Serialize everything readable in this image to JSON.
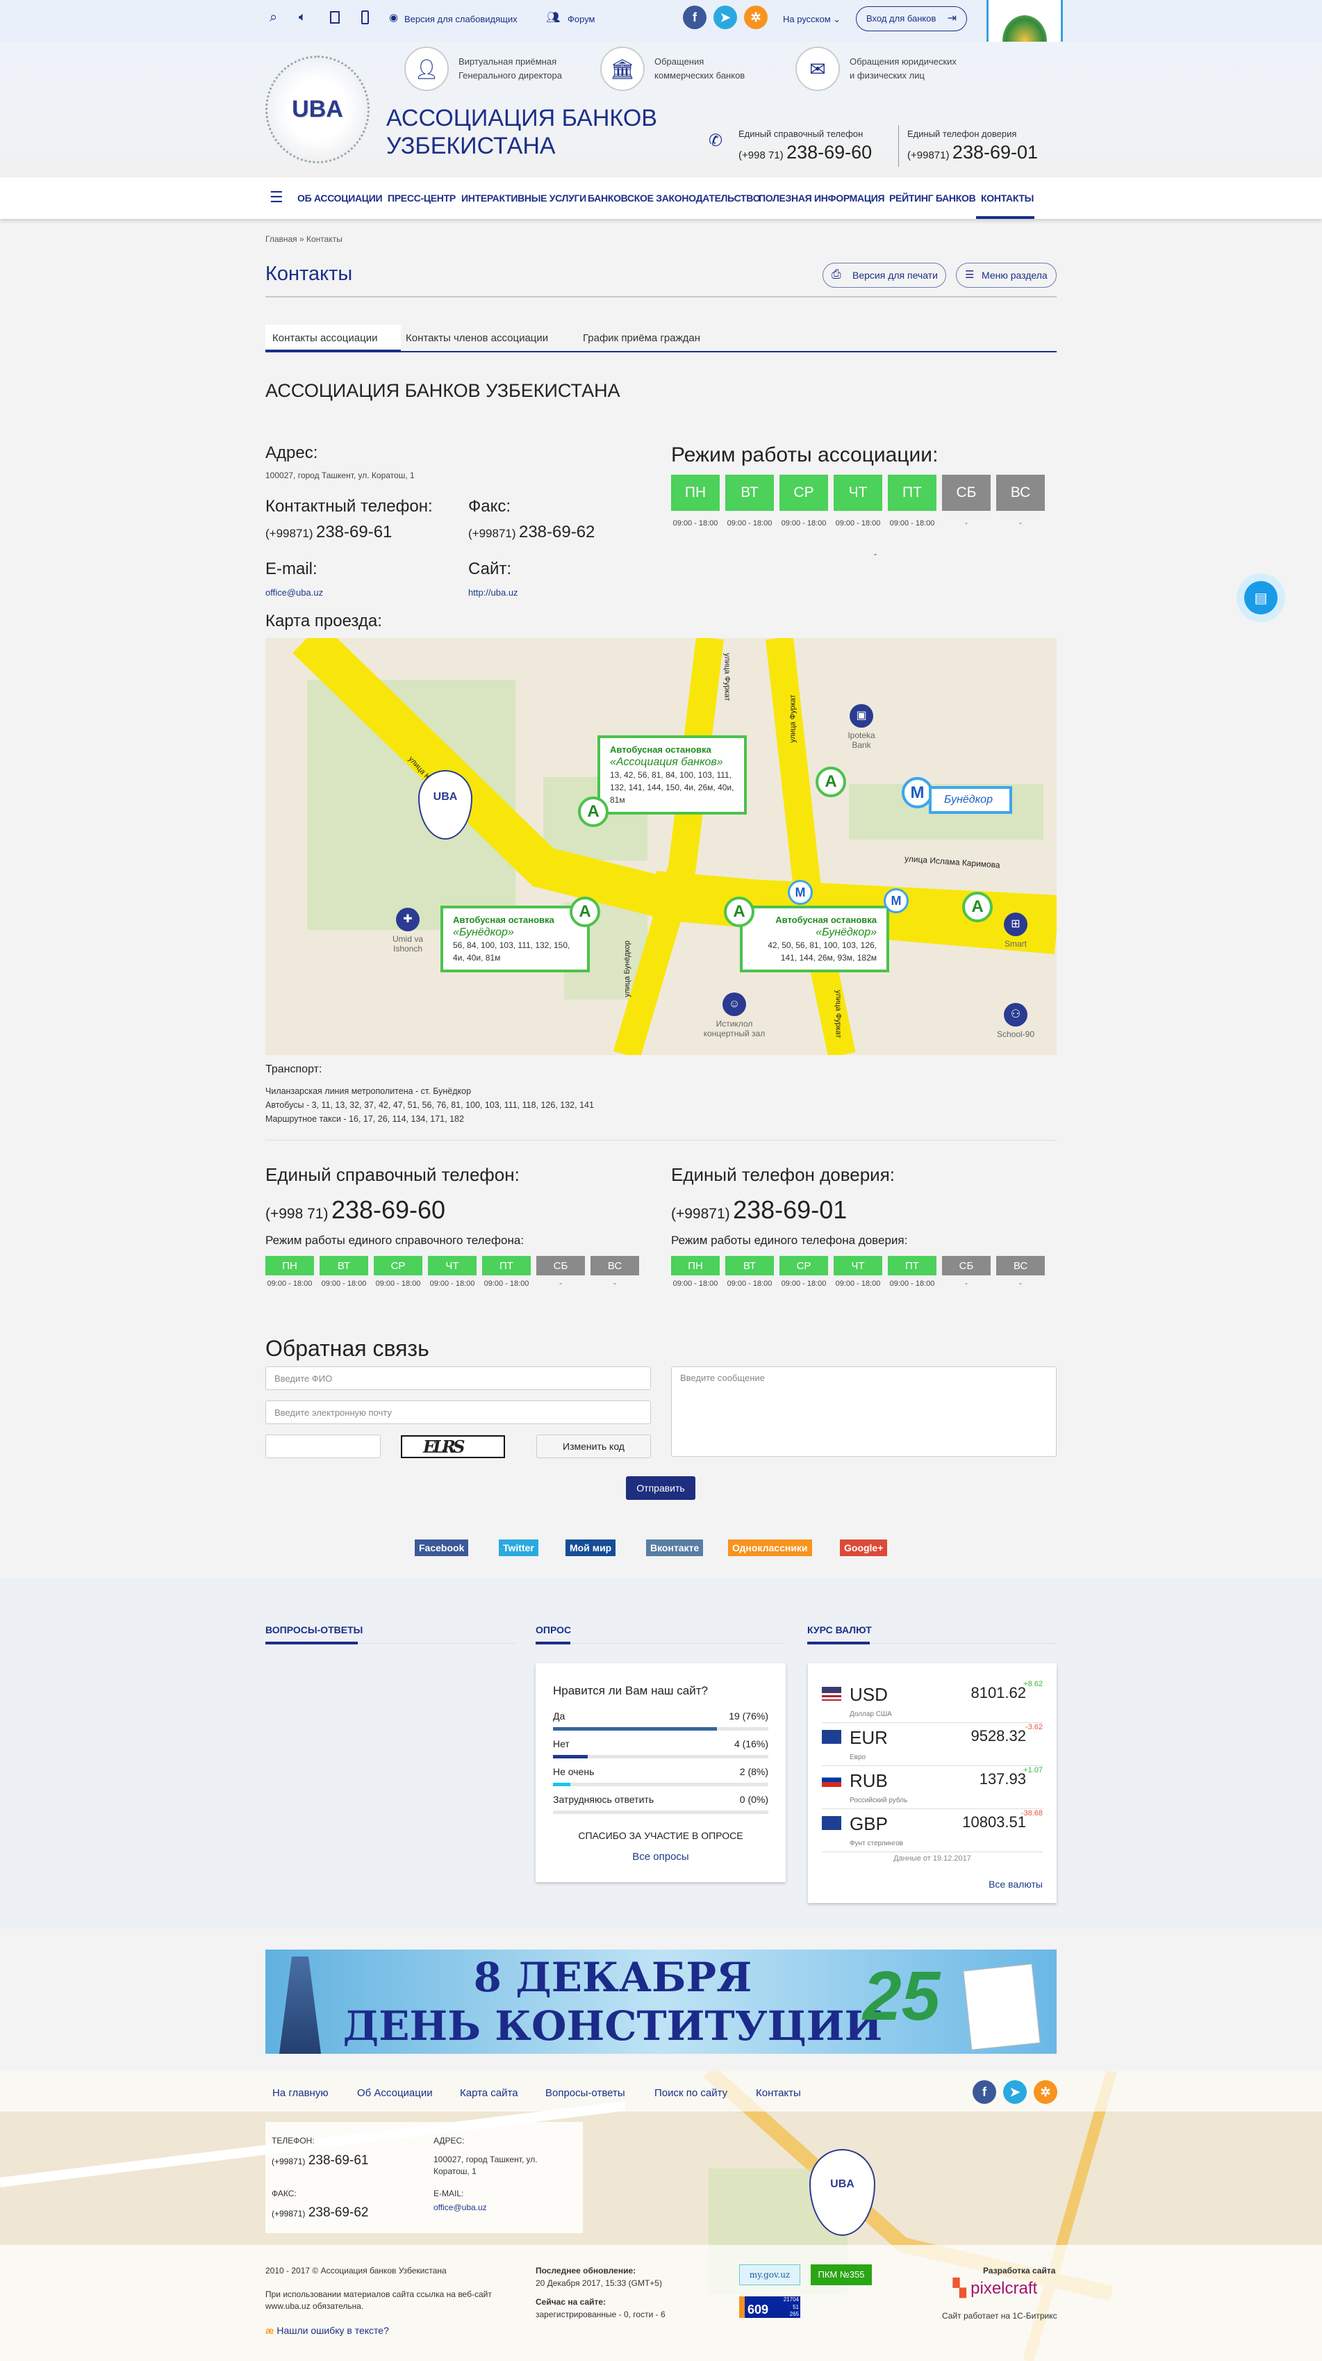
{
  "topbar": {
    "low_vision": "Версия для слабовидящих",
    "forum": "Форум",
    "language": "На русском",
    "bank_login": "Вход для банков",
    "icons": [
      "search-icon",
      "sound-icon",
      "rss-icon",
      "mobile-icon",
      "eye-icon",
      "forum-icon"
    ]
  },
  "header": {
    "logo_text": "UBA",
    "org_name_line1": "АССОЦИАЦИЯ БАНКОВ",
    "org_name_line2": "УЗБЕКИСТАНА",
    "services": [
      {
        "line1": "Виртуальная приёмная",
        "line2": "Генерального директора"
      },
      {
        "line1": "Обращения",
        "line2": "коммерческих банков"
      },
      {
        "line1": "Обращения юридических",
        "line2": "и физических лиц"
      }
    ],
    "phone1": {
      "label": "Единый справочный телефон",
      "prefix": "(+998 71)",
      "number": "238-69-60"
    },
    "phone2": {
      "label": "Единый телефон доверия",
      "prefix": "(+99871)",
      "number": "238-69-01"
    }
  },
  "nav": [
    "Об ассоциации",
    "Пресс-центр",
    "Интерактивные услуги",
    "Банковское законодательство",
    "Полезная информация",
    "Рейтинг банков",
    "Контакты"
  ],
  "breadcrumb": "Главная » Контакты",
  "page": {
    "title": "Контакты",
    "print": "Версия для печати",
    "menu": "Меню раздела",
    "tabs": [
      "Контакты ассоциации",
      "Контакты членов ассоциации",
      "График приёма граждан"
    ],
    "org_title": "АССОЦИАЦИЯ БАНКОВ УЗБЕКИСТАНА",
    "address_label": "Адрес:",
    "address": "100027, город Ташкент, ул. Коратош, 1",
    "phone_label": "Контактный телефон:",
    "phone_prefix": "(+99871)",
    "phone": "238-69-61",
    "fax_label": "Факс:",
    "fax_prefix": "(+99871)",
    "fax": "238-69-62",
    "email_label": "E-mail:",
    "email": "office@uba.uz",
    "site_label": "Сайт:",
    "site": "http://uba.uz",
    "schedule_title": "Режим работы ассоциации:",
    "schedule_note": "-",
    "map_label": "Карта проезда:",
    "transport_label": "Транспорт:",
    "transport": [
      "Чиланзарская линия метрополитена - ст. Бунёдкор",
      "Автобусы - 3, 11, 13, 32, 37, 42, 47, 51, 56, 76, 81, 100, 103, 111, 118, 126, 132, 141",
      "Маршрутное такси - 16, 17, 26, 114, 134, 171, 182"
    ],
    "hotline1": {
      "label": "Единый справочный телефон:",
      "prefix": "(+998 71)",
      "number": "238-69-60",
      "schedule_label": "Режим работы единого справочного телефона:"
    },
    "hotline2": {
      "label": "Единый телефон доверия:",
      "prefix": "(+99871)",
      "number": "238-69-01",
      "schedule_label": "Режим работы единого телефона доверия:"
    }
  },
  "days": [
    {
      "d": "ПН",
      "t": "09:00 - 18:00",
      "on": true
    },
    {
      "d": "ВТ",
      "t": "09:00 - 18:00",
      "on": true
    },
    {
      "d": "СР",
      "t": "09:00 - 18:00",
      "on": true
    },
    {
      "d": "ЧТ",
      "t": "09:00 - 18:00",
      "on": true
    },
    {
      "d": "ПТ",
      "t": "09:00 - 18:00",
      "on": true
    },
    {
      "d": "СБ",
      "t": "-",
      "on": false
    },
    {
      "d": "ВС",
      "t": "-",
      "on": false
    }
  ],
  "map": {
    "streets": [
      "улица Кораташ",
      "улица Фуркат",
      "улица Фуркат",
      "улица Ислама Каримова",
      "улица Бунёдкор",
      "улица Фуркат"
    ],
    "stops": [
      {
        "title": "Автобусная остановка",
        "name": "«Ассоциация банков»",
        "routes": "13, 42, 56, 81, 84, 100, 103, 111, 132, 141, 144, 150, 4и, 26м, 40и, 81м"
      },
      {
        "title": "Автобусная остановка",
        "name": "«Бунёдкор»",
        "routes": "56, 84, 100, 103, 111, 132, 150, 4и, 40и, 81м"
      },
      {
        "title": "Автобусная остановка",
        "name": "«Бунёдкор»",
        "routes": "42, 50, 56, 81, 100, 103, 126, 141, 144, 26м, 93м, 182м"
      }
    ],
    "metro": "Бунёдкор",
    "bus_letter": "A",
    "metro_letter": "M",
    "poi": [
      "Ipoteka Bank",
      "Umid va Ishonch",
      "Истиклол концертный зал",
      "Smart",
      "School-90"
    ]
  },
  "feedback": {
    "title": "Обратная связь",
    "name_ph": "Введите ФИО",
    "email_ph": "Введите электронную почту",
    "message_ph": "Введите сообщение",
    "captcha_text": "ELRS",
    "change_code": "Изменить код",
    "submit": "Отправить"
  },
  "share": [
    {
      "label": "Facebook",
      "color": "#3b5998"
    },
    {
      "label": "Twitter",
      "color": "#2aa9e0"
    },
    {
      "label": "Мой мир",
      "color": "#164d96"
    },
    {
      "label": "Вконтакте",
      "color": "#587ea3"
    },
    {
      "label": "Одноклассники",
      "color": "#f7931e"
    },
    {
      "label": "Google+",
      "color": "#dc4a38"
    }
  ],
  "widgets": {
    "faq": "ВОПРОСЫ-ОТВЕТЫ",
    "poll": "ОПРОС",
    "currency": "КУРС ВАЛЮТ"
  },
  "poll": {
    "question": "Нравится ли Вам наш сайт?",
    "options": [
      {
        "label": "Да",
        "result": "19 (76%)",
        "pct": 76,
        "color": "#336699"
      },
      {
        "label": "Нет",
        "result": "4 (16%)",
        "pct": 16,
        "color": "#1b3a8f"
      },
      {
        "label": "Не очень",
        "result": "2 (8%)",
        "pct": 8,
        "color": "#19c3f0"
      },
      {
        "label": "Затрудняюсь ответить",
        "result": "0 (0%)",
        "pct": 0,
        "color": "#999"
      }
    ],
    "thanks": "СПАСИБО ЗА УЧАСТИЕ В ОПРОСЕ",
    "all": "Все опросы"
  },
  "currency": {
    "rates": [
      {
        "code": "USD",
        "name": "Доллар США",
        "value": "8101.62",
        "delta": "+8.62",
        "up": true
      },
      {
        "code": "EUR",
        "name": "Евро",
        "value": "9528.32",
        "delta": "-3.62",
        "up": false
      },
      {
        "code": "RUB",
        "name": "Российский рубль",
        "value": "137.93",
        "delta": "+1.07",
        "up": true
      },
      {
        "code": "GBP",
        "name": "Фунт стерлингов",
        "value": "10803.51",
        "delta": "-38.68",
        "up": false
      }
    ],
    "date": "Данные от 19.12.2017",
    "all": "Все валюты"
  },
  "banner": {
    "line1": "8 ДЕКАБРЯ",
    "line2": "ДЕНЬ КОНСТИТУЦИИ",
    "number": "25"
  },
  "footer": {
    "nav": [
      "На главную",
      "Об Ассоциации",
      "Карта сайта",
      "Вопросы-ответы",
      "Поиск по сайту",
      "Контакты"
    ],
    "phone_label": "ТЕЛЕФОН:",
    "phone_prefix": "(+99871)",
    "phone": "238-69-61",
    "fax_label": "ФАКС:",
    "fax_prefix": "(+99871)",
    "fax": "238-69-62",
    "address_label": "АДРЕС:",
    "address": "100027, город Ташкент, ул. Коратош, 1",
    "email_label": "E-MAIL:",
    "email": "office@uba.uz",
    "copyright": "2010 - 2017 © Ассоциация банков Узбекистана",
    "notice": "При использовании материалов сайта ссылка на веб-сайт www.uba.uz обязательна.",
    "typo": "Нашли ошибку в тексте?",
    "updated_label": "Последнее обновление:",
    "updated": "20 Декабря 2017, 15:33 (GMT+5)",
    "online_label": "Сейчас на сайте:",
    "online": "зарегистрированные - 0, гости - 6",
    "badge_gov": "my.gov.uz",
    "badge_pkm": "ПКМ №355",
    "counter": {
      "main": "609",
      "a": "21704",
      "b": "51",
      "c": "265"
    },
    "dev_label": "Разработка сайта",
    "dev": "pixelcraft",
    "bitrix": "Сайт работает на 1С-Битрикс"
  }
}
